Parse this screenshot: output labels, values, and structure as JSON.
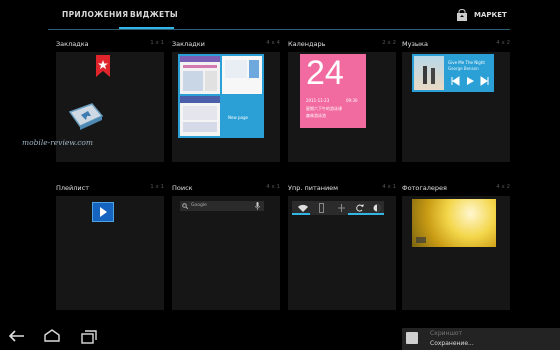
{
  "tabs": [
    {
      "label": "ПРИЛОЖЕНИЯ"
    },
    {
      "label": "ВИДЖЕТЫ"
    }
  ],
  "market": {
    "label": "МАРКЕТ"
  },
  "widgets": [
    {
      "title": "Закладка",
      "size": "1 x 1"
    },
    {
      "title": "Закладки",
      "size": "4 x 4"
    },
    {
      "title": "Календарь",
      "size": "2 x 2"
    },
    {
      "title": "Музыка",
      "size": "4 x 2"
    },
    {
      "title": "Плейлист",
      "size": "1 x 1"
    },
    {
      "title": "Поиск",
      "size": "4 x 1"
    },
    {
      "title": "Упр. питанием",
      "size": "4 x 1"
    },
    {
      "title": "Фотогалерея",
      "size": "4 x 2"
    }
  ],
  "calendar": {
    "day": "24",
    "date": "2011-11-23",
    "time": "09:30",
    "event": "星期六下午的游泳课",
    "place": "森林游泳池"
  },
  "music": {
    "title": "Give Me The Night",
    "artist": "George Benson"
  },
  "bookmarks": {
    "new_page": "New page"
  },
  "search": {
    "hint": "Google"
  },
  "watermark": "mobile-review.com",
  "notification": {
    "line1": "Скриншот",
    "line2": "Сохранение..."
  },
  "colors": {
    "accent": "#33b5e5",
    "calendar_pink": "#f26ba0",
    "bookmark_red": "#e0242b"
  }
}
